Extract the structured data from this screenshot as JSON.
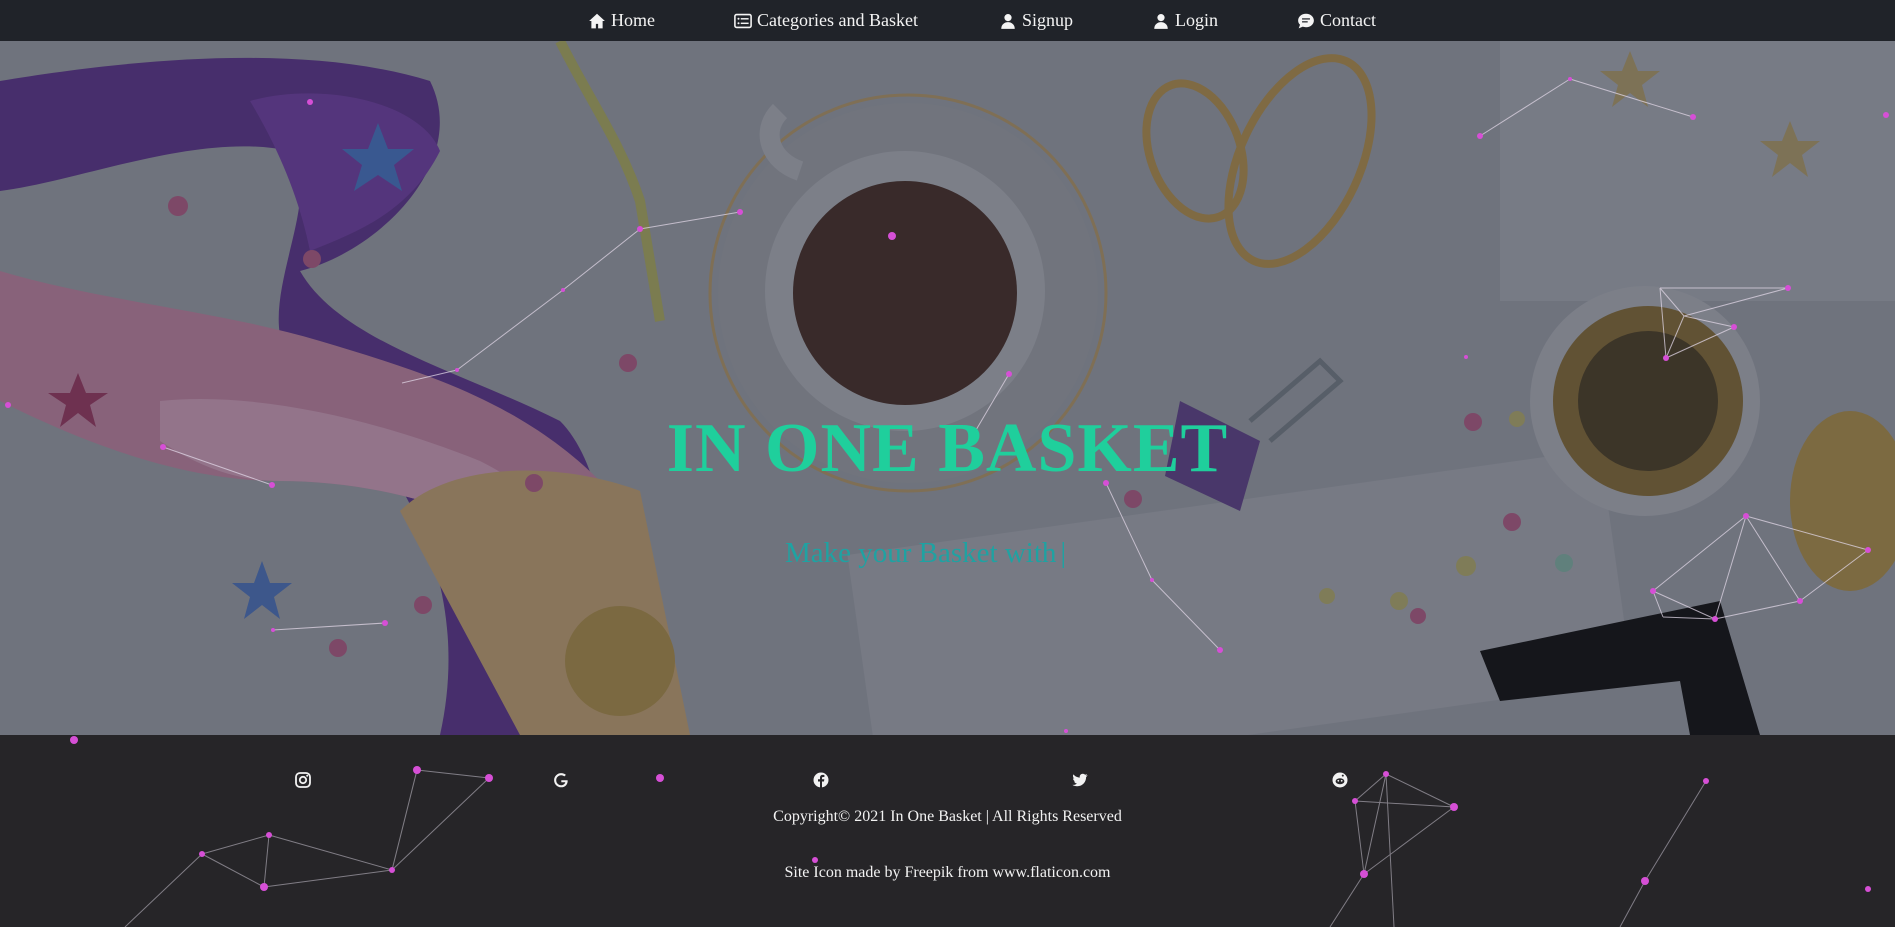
{
  "nav": {
    "items": [
      {
        "label": "Home",
        "icon": "home-icon"
      },
      {
        "label": "Categories and Basket",
        "icon": "list-card-icon"
      },
      {
        "label": "Signup",
        "icon": "person-icon"
      },
      {
        "label": "Login",
        "icon": "person-icon"
      },
      {
        "label": "Contact",
        "icon": "chat-icon"
      }
    ]
  },
  "hero": {
    "title": "IN ONE BASKET",
    "subtitle": "Make your Basket with",
    "caret": "|"
  },
  "footer": {
    "social": [
      "instagram-icon",
      "google-icon",
      "facebook-icon",
      "twitter-icon",
      "reddit-icon"
    ],
    "copyright": "Copyright© 2021  In One Basket | All Rights Reserved",
    "credit": "Site Icon made by Freepik from www.flaticon.com"
  },
  "colors": {
    "navbar": "#202329",
    "footer": "#262528",
    "title": "#1fcf9c",
    "subtitle": "#1fa2a2",
    "particle": "#d64fd6"
  }
}
